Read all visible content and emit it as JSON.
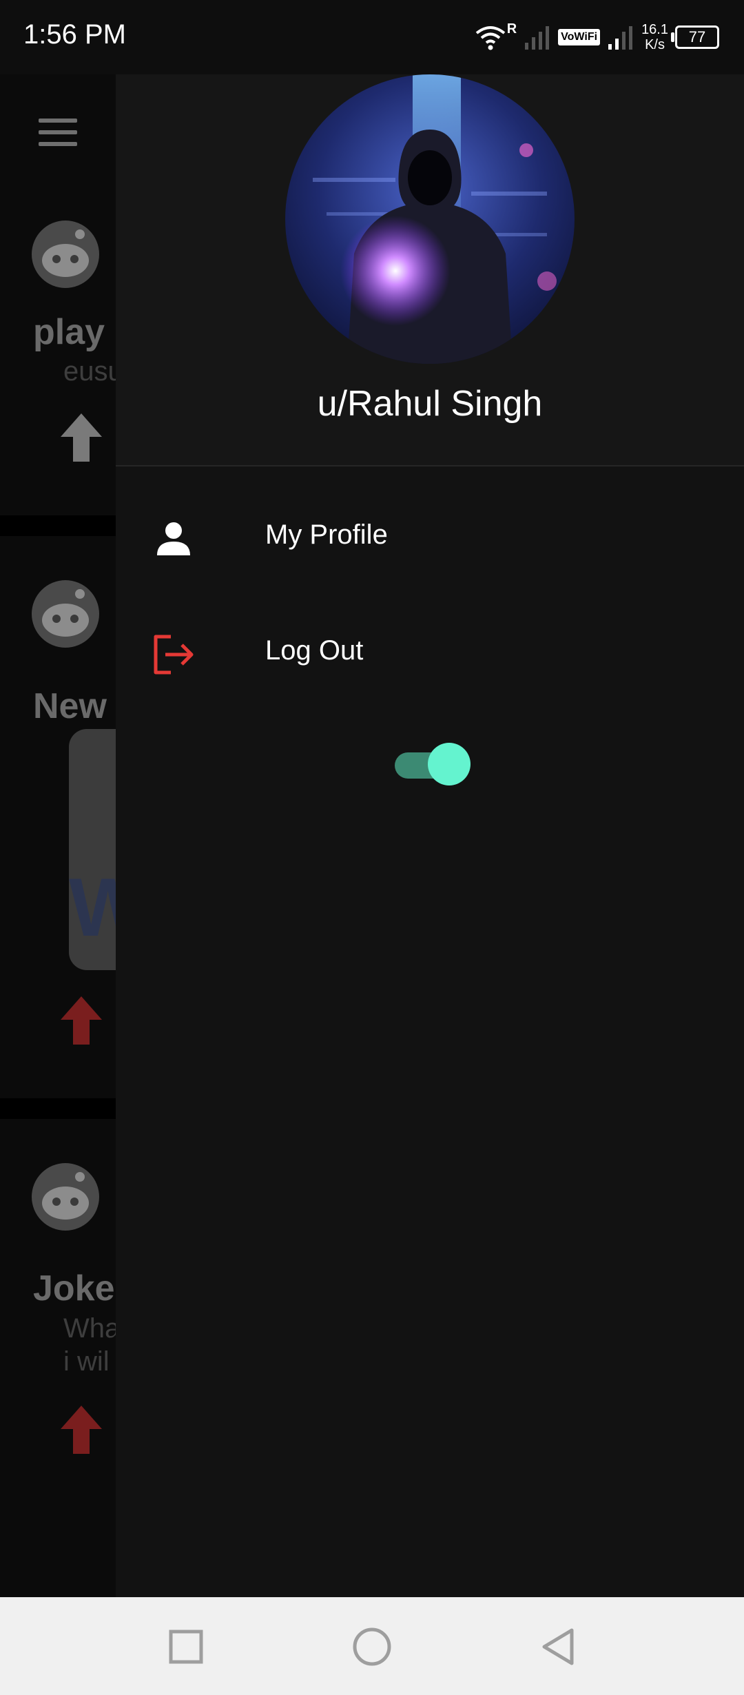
{
  "status_bar": {
    "time": "1:56 PM",
    "network_speed_value": "16.1",
    "network_speed_unit": "K/s",
    "roaming": "R",
    "vowifi": "VoWiFi",
    "battery": "77",
    "icons": [
      "wifi-icon",
      "signal-icon",
      "vowifi-icon",
      "signal-icon",
      "battery-icon"
    ]
  },
  "background_feed": {
    "posts": [
      {
        "title": "play",
        "body_lines": [
          "eusu"
        ],
        "upvote_color": "#7a7a7a"
      },
      {
        "title": "New",
        "body_lines": [],
        "upvote_color": "#7a1e1e"
      },
      {
        "title": "Joke",
        "body_lines": [
          "Wha",
          "i wil"
        ],
        "upvote_color": "#7a1e1e"
      }
    ]
  },
  "drawer": {
    "username": "u/Rahul Singh",
    "menu": [
      {
        "label": "My Profile",
        "icon": "person-icon"
      },
      {
        "label": "Log Out",
        "icon": "logout-icon",
        "icon_color": "#e53935"
      }
    ],
    "theme_toggle": {
      "on": true,
      "accent": "#64f3cf"
    }
  },
  "nav_bar": {
    "buttons": [
      "recents-button",
      "home-button",
      "back-button"
    ]
  }
}
